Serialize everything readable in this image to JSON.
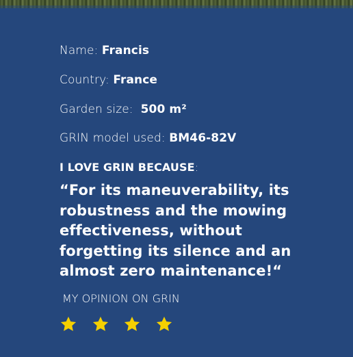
{
  "profile": {
    "name_label": "Name:",
    "name_value": "Francis",
    "country_label": "Country:",
    "country_value": "France",
    "garden_label": "Garden size:",
    "garden_value": "500 m²",
    "model_label": "GRIN model used:",
    "model_value": "BM46-82V"
  },
  "testimonial": {
    "heading": "I LOVE GRIN BECAUSE",
    "heading_suffix": ":",
    "quote": "“For its maneuverability, its robustness and the mowing effectiveness, without forgetting its silence and an almost zero maintenance!“"
  },
  "opinion": {
    "label": "MY OPINION ON GRIN",
    "rating": 4,
    "star_color": "#f5d000"
  },
  "colors": {
    "background": "#25477c",
    "text": "#ffffff"
  }
}
